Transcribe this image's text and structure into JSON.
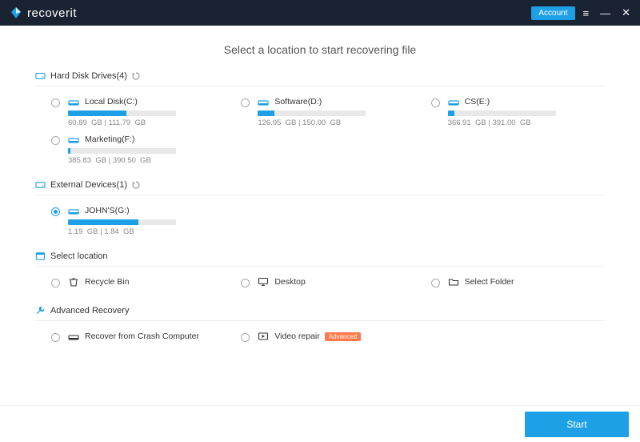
{
  "header": {
    "brand": "recoverit",
    "account_label": "Account"
  },
  "title": "Select a location to start recovering file",
  "sections": {
    "hdd": {
      "label": "Hard Disk Drives(4)"
    },
    "ext": {
      "label": "External Devices(1)"
    },
    "loc": {
      "label": "Select location"
    },
    "adv": {
      "label": "Advanced Recovery"
    }
  },
  "drives": {
    "c": {
      "name": "Local Disk(C:)",
      "used": "60.89",
      "total": "111.79",
      "unit": "GB",
      "pct": 54
    },
    "d": {
      "name": "Software(D:)",
      "used": "126.95",
      "total": "150.00",
      "unit": "GB",
      "pct": 15
    },
    "e": {
      "name": "CS(E:)",
      "used": "366.91",
      "total": "391.00",
      "unit": "GB",
      "pct": 6
    },
    "f": {
      "name": "Marketing(F:)",
      "used": "385.83",
      "total": "390.50",
      "unit": "GB",
      "pct": 2
    },
    "g": {
      "name": "JOHN'S(G:)",
      "used": "1.19",
      "total": "1.84",
      "unit": "GB",
      "pct": 65
    }
  },
  "locations": {
    "recycle": {
      "name": "Recycle Bin"
    },
    "desktop": {
      "name": "Desktop"
    },
    "folder": {
      "name": "Select Folder"
    }
  },
  "advanced": {
    "crash": {
      "name": "Recover from Crash Computer"
    },
    "video": {
      "name": "Video repair",
      "badge": "Advanced"
    }
  },
  "start_label": "Start",
  "colors": {
    "accent": "#1ea0e6",
    "header_bg": "#1a2332",
    "badge": "#ff7849"
  }
}
